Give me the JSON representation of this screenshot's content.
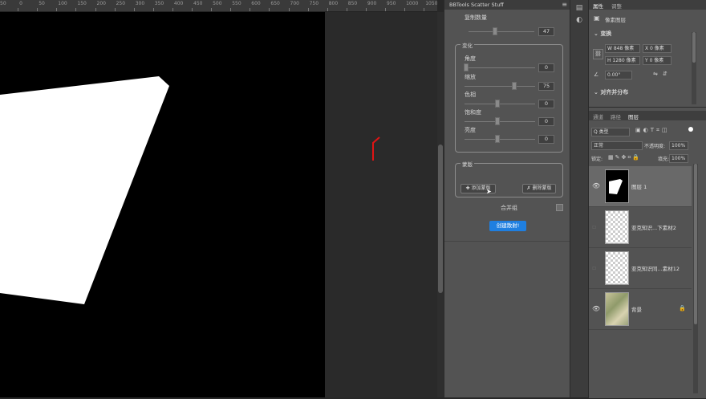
{
  "ruler": {
    "ticks": [
      "50",
      "0",
      "50",
      "100",
      "150",
      "200",
      "250",
      "300",
      "350",
      "400",
      "450",
      "500",
      "550",
      "600",
      "650",
      "700",
      "750",
      "800",
      "850",
      "900",
      "950",
      "1000",
      "1050",
      "1100"
    ]
  },
  "document_tab": "未命名-1@66.7%(RGB/8) ×    liman_..._1280.jpg @ 66.7% (图层 1, RGB/8#)",
  "scatter": {
    "title": "BBTools Scatter Stuff",
    "copy_count": {
      "label": "复制数量",
      "value": "47"
    },
    "variation": {
      "title": "变化",
      "angle": {
        "label": "角度",
        "value": "0"
      },
      "scale": {
        "label": "缩放",
        "value": "75"
      },
      "hue": {
        "label": "色相",
        "value": "0"
      },
      "saturation": {
        "label": "饱和度",
        "value": "0"
      },
      "lightness": {
        "label": "亮度",
        "value": "0"
      }
    },
    "mask": {
      "title": "蒙版",
      "add_label": "✚ 添加蒙版",
      "delete_label": "✗ 删除蒙版"
    },
    "merge_label": "合并组",
    "scatter_button": "创建散射!"
  },
  "properties": {
    "tabs": [
      "属性",
      "调整"
    ],
    "layer_type": "像素图层",
    "transform_title": "变换",
    "w": "W 848 像素",
    "x": "X 0 像素",
    "h": "H 1280 像素",
    "y": "Y 0 像素",
    "angle": "0.00°",
    "align_title": "对齐并分布"
  },
  "layers_panel": {
    "tabs": [
      "通道",
      "路径",
      "图层"
    ],
    "filter": "Q 类型",
    "blend_mode": "正常",
    "opacity_label": "不透明度:",
    "opacity_value": "100%",
    "lock_label": "锁定:",
    "fill_label": "填充:",
    "fill_value": "100%",
    "layers": [
      {
        "name": "图层 1",
        "visible": true,
        "selected": true
      },
      {
        "name": "亚克知识...下素材2",
        "visible": false,
        "selected": false
      },
      {
        "name": "亚克知识同...素材12",
        "visible": false,
        "selected": false
      },
      {
        "name": "背景",
        "visible": true,
        "selected": false,
        "locked": true
      }
    ]
  },
  "colors": {
    "accent": "#1f7fe0",
    "panel": "#535353",
    "canvas": "#000000",
    "cursor_red": "#e01414"
  }
}
